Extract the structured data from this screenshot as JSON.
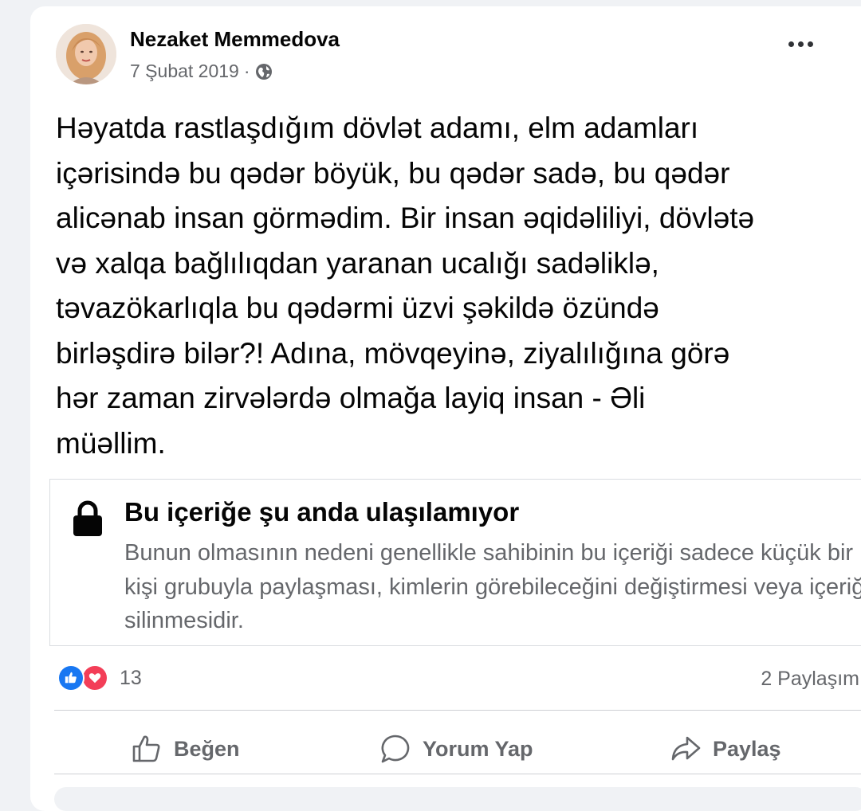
{
  "post": {
    "author": "Nezaket Memmedova",
    "date": "7 Şubat 2019",
    "meta_separator": "·",
    "privacy_icon": "globe-icon",
    "more_icon": "more-options-icon",
    "text": "Həyatda rastlaşdığım dövlət adamı, elm adamları\niçərisində bu qədər böyük, bu qədər sadə, bu qədər\nalicənab insan görmədim. Bir insan əqidəliliyi, dövlətə\nvə xalqa bağlılıqdan yaranan ucalığı sadəliklə,\ntəvazökarlıqla bu qədərmi üzvi şəkildə özündə\nbirləşdirə bilər?! Adına, mövqeyinə, ziyalılığına görə\nhər zaman zirvələrdə olmağa layiq insan - Əli\nmüəllim."
  },
  "notice": {
    "icon": "lock-icon",
    "title": "Bu içeriğe şu anda ulaşılamıyor",
    "body": "Bunun olmasının nedeni genellikle sahibinin bu içeriği sadece küçük bir kişi grubuyla paylaşması, kimlerin görebileceğini değiştirmesi veya içeriğin silinmesidir."
  },
  "stats": {
    "reaction_icons": [
      "like-reaction-icon",
      "love-reaction-icon"
    ],
    "reaction_count": "13",
    "shares": "2 Paylaşım"
  },
  "actions": {
    "like": "Beğen",
    "comment": "Yorum Yap",
    "share": "Paylaş"
  },
  "colors": {
    "like_blue": "#1877f2",
    "love_red": "#f33e58",
    "secondary_text": "#65676b",
    "primary_text": "#050505"
  }
}
